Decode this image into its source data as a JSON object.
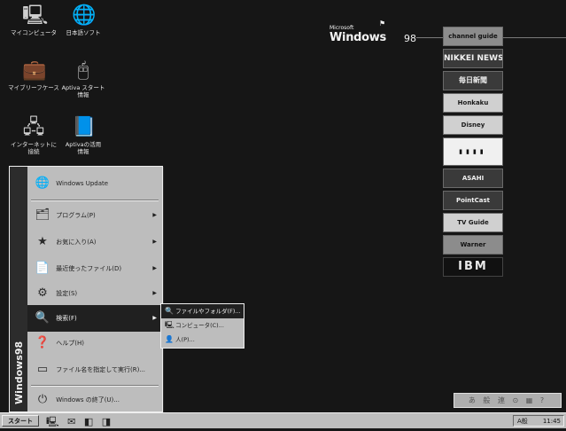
{
  "desktop": {
    "icons": [
      {
        "label": "マイコンピュータ",
        "glyph": "🖳",
        "icon": "my-computer-icon"
      },
      {
        "label": "日本語ソフト",
        "glyph": "🌐",
        "icon": "globe-icon"
      },
      {
        "label": "マイブリーフケース",
        "glyph": "💼",
        "icon": "briefcase-icon"
      },
      {
        "label": "Aptiva スタート\n情報",
        "glyph": "🖰",
        "icon": "aptiva-start-icon"
      },
      {
        "label": "インターネットに\n接続",
        "glyph": "🖧",
        "icon": "internet-connect-icon"
      },
      {
        "label": "Aptivaの活用\n情報",
        "glyph": "📘",
        "icon": "aptiva-info-icon"
      }
    ]
  },
  "logo": {
    "microsoft": "Microsoft",
    "word": "Windows",
    "version": "98"
  },
  "channel_bar": [
    "channel guide",
    "NIKKEI NEWS",
    "毎日新聞",
    "Honkaku",
    "Disney",
    "▮▮▮▮",
    "ASAHI",
    "PointCast",
    "TV Guide",
    "Warner",
    "IBM"
  ],
  "start_menu": {
    "side_banner": "Windows98",
    "items": [
      {
        "label": "Windows Update",
        "glyph": "🌐",
        "icon": "windows-update-icon",
        "arrow": false
      },
      {
        "label": "プログラム(P)",
        "glyph": "🗂",
        "icon": "programs-icon",
        "arrow": true
      },
      {
        "label": "お気に入り(A)",
        "glyph": "★",
        "icon": "favorites-icon",
        "arrow": true
      },
      {
        "label": "最近使ったファイル(D)",
        "glyph": "📄",
        "icon": "documents-icon",
        "arrow": true
      },
      {
        "label": "設定(S)",
        "glyph": "⚙",
        "icon": "settings-icon",
        "arrow": true
      },
      {
        "label": "検索(F)",
        "glyph": "🔍",
        "icon": "find-icon",
        "arrow": true
      },
      {
        "label": "ヘルプ(H)",
        "glyph": "❓",
        "icon": "help-icon",
        "arrow": false
      },
      {
        "label": "ファイル名を指定して実行(R)...",
        "glyph": "▭",
        "icon": "run-icon",
        "arrow": false
      },
      {
        "label": "Windows の終了(U)...",
        "glyph": "⏻",
        "icon": "shutdown-icon",
        "arrow": false
      }
    ]
  },
  "submenu": {
    "items": [
      {
        "label": "ファイルやフォルダ(F)...",
        "glyph": "🔍"
      },
      {
        "label": "コンピュータ(C)...",
        "glyph": "🖳"
      },
      {
        "label": "人(P)...",
        "glyph": "👤"
      }
    ]
  },
  "taskbar": {
    "start_label": "スタート",
    "quick_launch": "🖳 ✉ ◧ ◨",
    "tray_text": "A般",
    "time": "11:45"
  },
  "ime_bar": "あ 般 連 ⊙ ▦ ?"
}
